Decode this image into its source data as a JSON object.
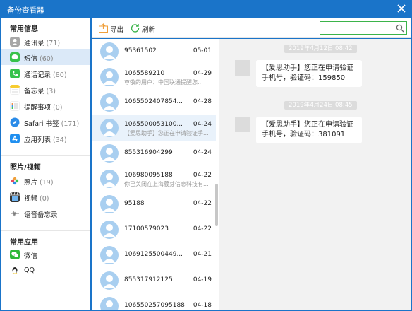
{
  "window": {
    "title": "备份查看器",
    "close_icon": "close-icon"
  },
  "sidebar": {
    "sections": [
      {
        "title": "常用信息"
      },
      {
        "title": "照片/视频"
      },
      {
        "title": "常用应用"
      }
    ],
    "items": [
      {
        "label": "通讯录",
        "count": "(71)",
        "icon": "contacts-icon",
        "color": "#a7a7a7"
      },
      {
        "label": "短信",
        "count": "(60)",
        "icon": "message-icon",
        "color": "#38c24b"
      },
      {
        "label": "通话记录",
        "count": "(80)",
        "icon": "phone-icon",
        "color": "#38c24b"
      },
      {
        "label": "备忘录",
        "count": "(3)",
        "icon": "notes-icon",
        "color": "#f7cc2f"
      },
      {
        "label": "提醒事项",
        "count": "(0)",
        "icon": "reminders-icon",
        "color": "#ffffff"
      },
      {
        "label": "Safari 书签",
        "count": "(171)",
        "icon": "safari-icon",
        "color": "#2a8be8"
      },
      {
        "label": "应用列表",
        "count": "(34)",
        "icon": "appstore-icon",
        "color": "#1f8ff0"
      },
      {
        "label": "照片",
        "count": "(19)",
        "icon": "photos-icon",
        "color": "#f0a03c"
      },
      {
        "label": "视频",
        "count": "(0)",
        "icon": "video-icon",
        "color": "#333333"
      },
      {
        "label": "语音备忘录",
        "count": "",
        "icon": "voice-memo-icon",
        "color": "#777777"
      },
      {
        "label": "微信",
        "count": "",
        "icon": "wechat-icon",
        "color": "#2db838"
      },
      {
        "label": "QQ",
        "count": "",
        "icon": "qq-icon",
        "color": "#222222"
      }
    ]
  },
  "toolbar": {
    "export_label": "导出",
    "refresh_label": "刷新",
    "search_placeholder": ""
  },
  "messages": [
    {
      "name": "95361502",
      "date": "05-01",
      "preview": ""
    },
    {
      "name": "1065589210",
      "date": "04-29",
      "preview": "尊敬的用户：中国联通提醒您..."
    },
    {
      "name": "1065502407854...",
      "date": "04-28",
      "preview": ""
    },
    {
      "name": "1065500053100...",
      "date": "04-24",
      "preview": "【爱思助手】您正在申请验证手..."
    },
    {
      "name": "855316904299",
      "date": "04-24",
      "preview": ""
    },
    {
      "name": "106980095188",
      "date": "04-22",
      "preview": "你已关闭在上海葳芽信息科技有..."
    },
    {
      "name": "95188",
      "date": "04-22",
      "preview": ""
    },
    {
      "name": "17100579023",
      "date": "04-22",
      "preview": ""
    },
    {
      "name": "1069125500449...",
      "date": "04-21",
      "preview": ""
    },
    {
      "name": "855317912125",
      "date": "04-19",
      "preview": ""
    },
    {
      "name": "106550257095188",
      "date": "04-18",
      "preview": ""
    }
  ],
  "conversation": [
    {
      "timestamp": "2019年4月12日 08:42",
      "text": "【爱思助手】您正在申请验证手机号，验证码：159850"
    },
    {
      "timestamp": "2019年4月24日 08:45",
      "text": "【爱思助手】您正在申请验证手机号，验证码：381091"
    }
  ],
  "colors": {
    "titlebar": "#1a74c9",
    "accent_green": "#3bb34a",
    "selected_row": "#dbe9f8"
  }
}
